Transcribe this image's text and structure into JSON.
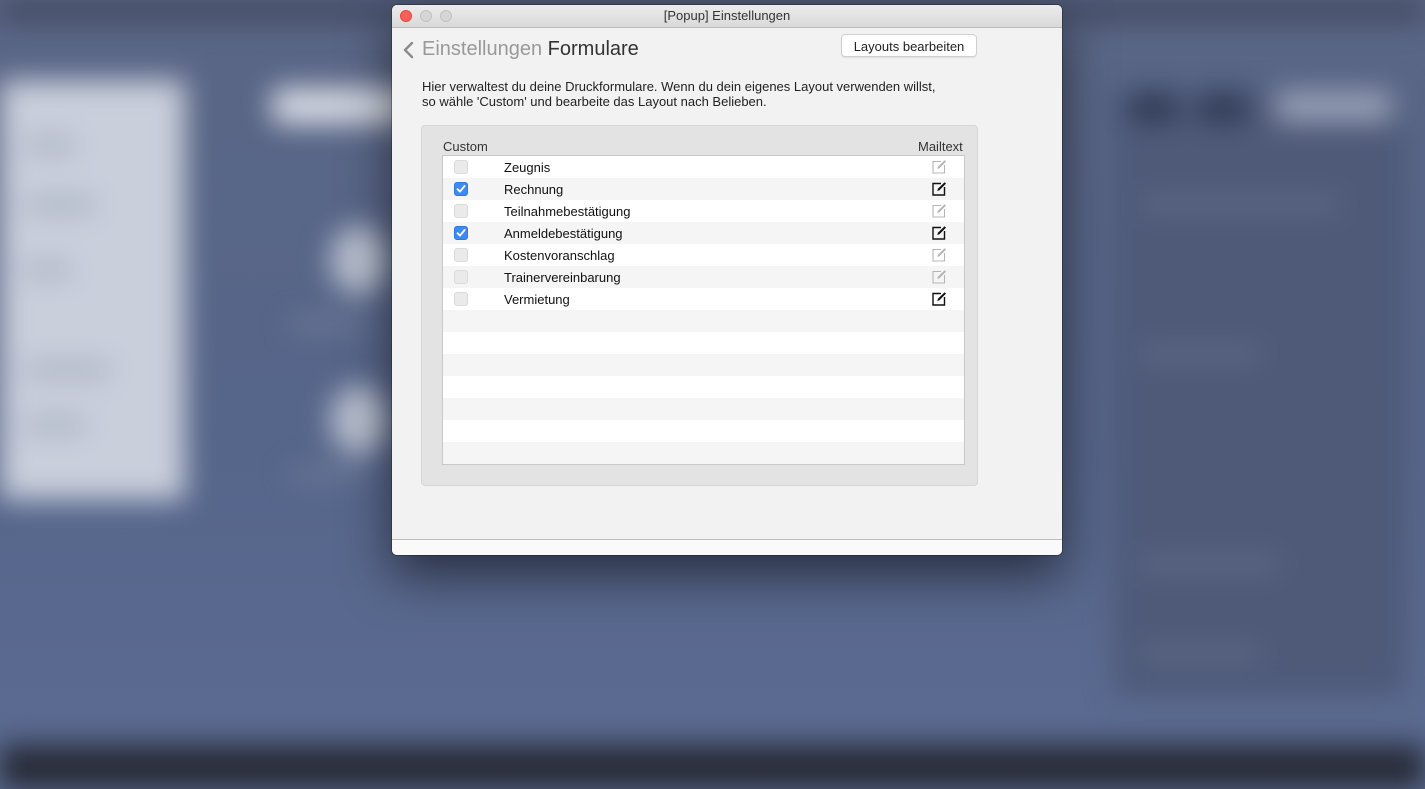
{
  "window": {
    "title": "[Popup] Einstellungen"
  },
  "header": {
    "breadcrumb_parent": "Einstellungen",
    "breadcrumb_current": "Formulare",
    "layouts_button_label": "Layouts bearbeiten"
  },
  "description": {
    "line1": "Hier verwaltest du deine Druckformulare. Wenn du dein eigenes Layout verwenden willst,",
    "line2": "so wähle 'Custom' und bearbeite das Layout nach Belieben."
  },
  "table": {
    "columns": {
      "custom": "Custom",
      "mailtext": "Mailtext"
    },
    "rows": [
      {
        "label": "Zeugnis",
        "custom": false,
        "mailtext_set": false
      },
      {
        "label": "Rechnung",
        "custom": true,
        "mailtext_set": true
      },
      {
        "label": "Teilnahmebestätigung",
        "custom": false,
        "mailtext_set": false
      },
      {
        "label": "Anmeldebestätigung",
        "custom": true,
        "mailtext_set": true
      },
      {
        "label": "Kostenvoranschlag",
        "custom": false,
        "mailtext_set": false
      },
      {
        "label": "Trainervereinbarung",
        "custom": false,
        "mailtext_set": false
      },
      {
        "label": "Vermietung",
        "custom": false,
        "mailtext_set": true
      }
    ]
  },
  "icons": {
    "back": "chevron-left-icon",
    "edit": "edit-note-icon"
  },
  "colors": {
    "checkbox_checked": "#3d8bf0",
    "close_button": "#fc5f57",
    "edit_active": "#111111",
    "edit_inactive": "#b5b5b5"
  }
}
